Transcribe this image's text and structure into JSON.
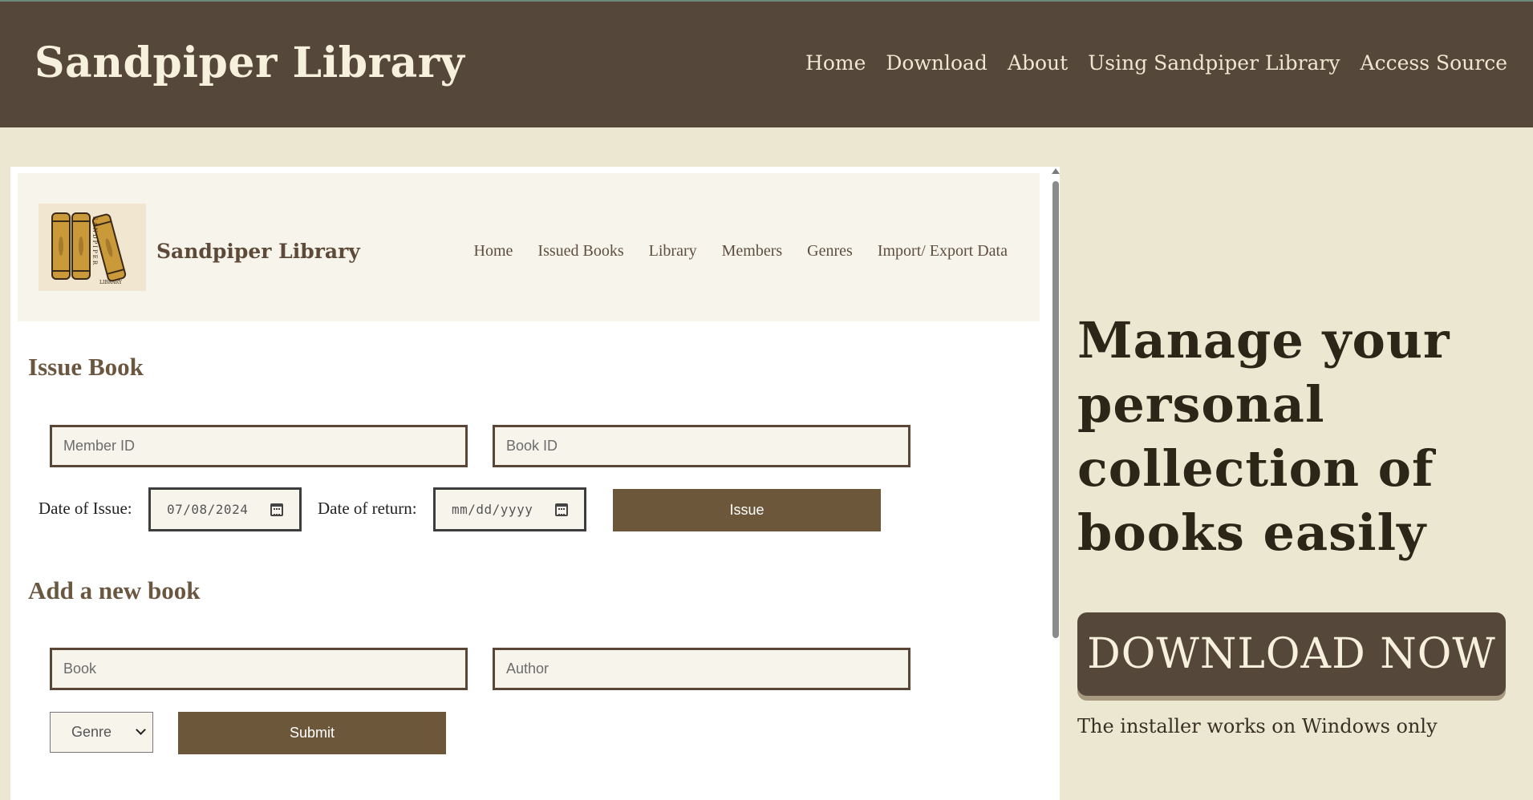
{
  "site": {
    "title": "Sandpiper Library",
    "nav": [
      "Home",
      "Download",
      "About",
      "Using Sandpiper Library",
      "Access Source"
    ]
  },
  "app": {
    "title": "Sandpiper Library",
    "nav": [
      "Home",
      "Issued Books",
      "Library",
      "Members",
      "Genres",
      "Import/ Export Data"
    ],
    "logo_text": "SANDPIPER LIBRARY"
  },
  "issue_book": {
    "heading": "Issue Book",
    "member_id_placeholder": "Member ID",
    "book_id_placeholder": "Book ID",
    "date_of_issue_label": "Date of Issue:",
    "date_of_issue_value": "07/08/2024",
    "date_of_return_label": "Date of return:",
    "date_of_return_value": "mm/dd/yyyy",
    "issue_button": "Issue"
  },
  "add_book": {
    "heading": "Add a new book",
    "book_placeholder": "Book",
    "author_placeholder": "Author",
    "genre_selected": "Genre",
    "submit_button": "Submit"
  },
  "hero": {
    "headline": "Manage your personal collection of books easily",
    "download_button": "DOWNLOAD NOW",
    "installer_note": "The installer works on Windows only"
  },
  "colors": {
    "header_bg": "#56473b",
    "page_bg": "#ece7d1",
    "button_brown": "#6d573b"
  }
}
